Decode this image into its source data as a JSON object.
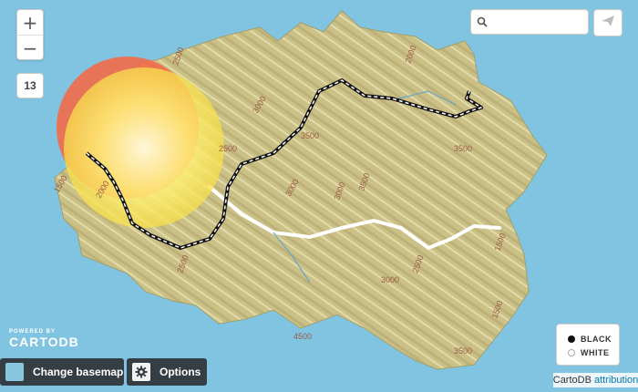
{
  "map": {
    "zoom_in": "+",
    "zoom_out": "−",
    "zoom_level": "13",
    "contour_labels": [
      "2500",
      "2000",
      "3000",
      "2500",
      "3500",
      "3500",
      "3000",
      "3000",
      "1500",
      "3500",
      "2500",
      "2500",
      "3000",
      "4500",
      "3500",
      "1500",
      "1500",
      "2000"
    ]
  },
  "search": {
    "placeholder": "",
    "icon": "search-icon"
  },
  "share": {
    "icon": "share-icon"
  },
  "legend": {
    "items": [
      {
        "label": "BLACK",
        "color": "#111111"
      },
      {
        "label": "WHITE",
        "color": "#ffffff"
      }
    ]
  },
  "branding": {
    "powered": "POWERED BY",
    "name": "CARTODB"
  },
  "controls": {
    "basemap_label": "Change basemap",
    "options_label": "Options"
  },
  "attribution": {
    "provider": "CartoDB",
    "link": "attribution"
  },
  "colors": {
    "water": "#80c4e1",
    "land": "#b8ad6a",
    "heat": "#f26b4a",
    "heat_core": "#fff8a8"
  }
}
